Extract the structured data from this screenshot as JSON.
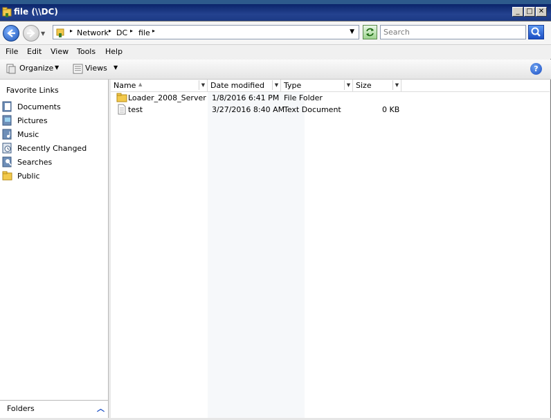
{
  "window": {
    "title": "file (\\\\DC)",
    "min_glyph": "_",
    "max_glyph": "□",
    "close_glyph": "✕"
  },
  "address": {
    "crumbs": [
      "Network",
      "DC",
      "file"
    ],
    "arrow_glyph": "▸"
  },
  "search": {
    "placeholder": "Search"
  },
  "menu": [
    "File",
    "Edit",
    "View",
    "Tools",
    "Help"
  ],
  "toolbar": {
    "organize_label": "Organize",
    "views_label": "Views",
    "help_glyph": "?"
  },
  "nav": {
    "title": "Favorite Links",
    "links": [
      {
        "label": "Documents",
        "icon": "documents-icon"
      },
      {
        "label": "Pictures",
        "icon": "pictures-icon"
      },
      {
        "label": "Music",
        "icon": "music-icon"
      },
      {
        "label": "Recently Changed",
        "icon": "recently-changed-icon"
      },
      {
        "label": "Searches",
        "icon": "searches-icon"
      },
      {
        "label": "Public",
        "icon": "public-folder-icon"
      }
    ],
    "folders_label": "Folders"
  },
  "table": {
    "columns": [
      "Name",
      "Date modified",
      "Type",
      "Size"
    ],
    "rows": [
      {
        "name": "Loader_2008_Server",
        "date": "1/8/2016 6:41 PM",
        "type": "File Folder",
        "size": "",
        "icon": "folder-icon"
      },
      {
        "name": "test",
        "date": "3/27/2016 8:40 AM",
        "type": "Text Document",
        "size": "0 KB",
        "icon": "text-document-icon"
      }
    ]
  },
  "colors": {
    "titlebar": "#0a246a",
    "accent_blue": "#1b4ec4",
    "folder_yellow": "#f2c94c"
  }
}
